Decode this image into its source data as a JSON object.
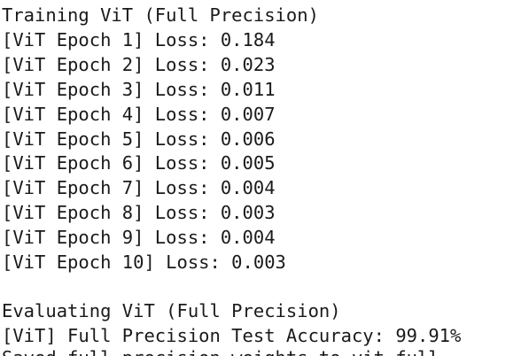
{
  "output": {
    "header": "Training ViT (Full Precision)",
    "epochs": [
      "[ViT Epoch 1] Loss: 0.184",
      "[ViT Epoch 2] Loss: 0.023",
      "[ViT Epoch 3] Loss: 0.011",
      "[ViT Epoch 4] Loss: 0.007",
      "[ViT Epoch 5] Loss: 0.006",
      "[ViT Epoch 6] Loss: 0.005",
      "[ViT Epoch 7] Loss: 0.004",
      "[ViT Epoch 8] Loss: 0.003",
      "[ViT Epoch 9] Loss: 0.004",
      "[ViT Epoch 10] Loss: 0.003"
    ],
    "eval_header": "Evaluating ViT (Full Precision)",
    "accuracy_line": "[ViT] Full Precision Test Accuracy: 99.91%",
    "cut_line": "Saved full precision weights to vit_full..."
  }
}
